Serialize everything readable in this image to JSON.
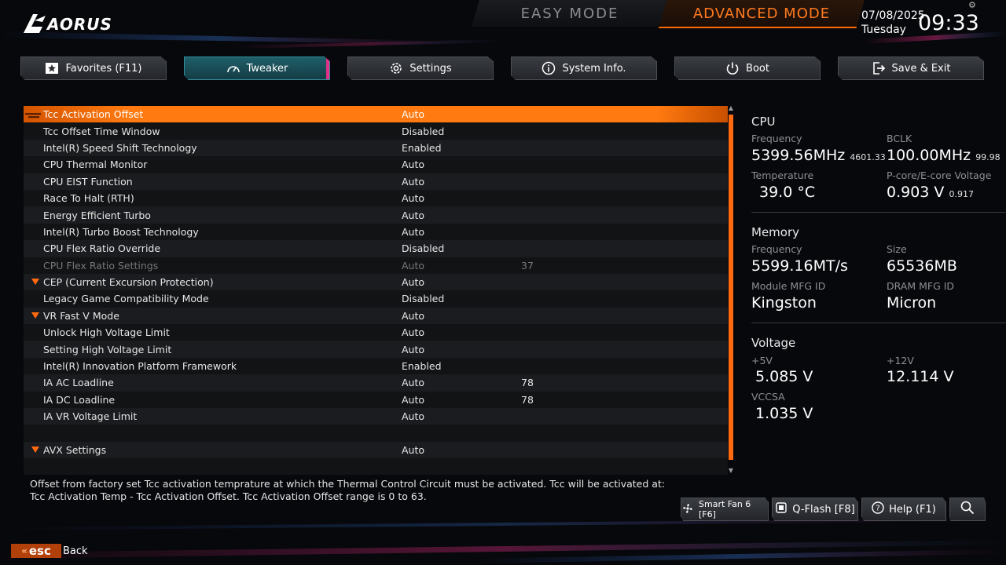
{
  "header": {
    "logo_text": "AORUS",
    "easy_mode": "EASY MODE",
    "advanced_mode": "ADVANCED MODE",
    "date": "07/08/2025",
    "day": "Tuesday",
    "time": "09:33"
  },
  "tabs": [
    {
      "label": "Favorites (F11)",
      "icon": "star-icon"
    },
    {
      "label": "Tweaker",
      "icon": "speedometer-icon",
      "active": true
    },
    {
      "label": "Settings",
      "icon": "gear-icon"
    },
    {
      "label": "System Info.",
      "icon": "info-icon"
    },
    {
      "label": "Boot",
      "icon": "power-icon"
    },
    {
      "label": "Save & Exit",
      "icon": "exit-icon"
    }
  ],
  "settings": [
    {
      "name": "Tcc Activation Offset",
      "value": "Auto",
      "num": "",
      "selected": true
    },
    {
      "name": "Tcc Offset Time Window",
      "value": "Disabled",
      "num": ""
    },
    {
      "name": "Intel(R) Speed Shift Technology",
      "value": "Enabled",
      "num": ""
    },
    {
      "name": "CPU Thermal Monitor",
      "value": "Auto",
      "num": ""
    },
    {
      "name": "CPU EIST Function",
      "value": "Auto",
      "num": ""
    },
    {
      "name": "Race To Halt (RTH)",
      "value": "Auto",
      "num": ""
    },
    {
      "name": "Energy Efficient Turbo",
      "value": "Auto",
      "num": ""
    },
    {
      "name": "Intel(R) Turbo Boost Technology",
      "value": "Auto",
      "num": ""
    },
    {
      "name": "CPU Flex Ratio Override",
      "value": "Disabled",
      "num": ""
    },
    {
      "name": "CPU Flex Ratio Settings",
      "value": "Auto",
      "num": "37",
      "dim": true
    },
    {
      "name": "CEP (Current Excursion Protection)",
      "value": "Auto",
      "num": "",
      "expand": true
    },
    {
      "name": "Legacy Game Compatibility Mode",
      "value": "Disabled",
      "num": ""
    },
    {
      "name": "VR Fast V Mode",
      "value": "Auto",
      "num": "",
      "expand": true
    },
    {
      "name": "Unlock High Voltage Limit",
      "value": "Auto",
      "num": ""
    },
    {
      "name": "Setting High Voltage Limit",
      "value": "Auto",
      "num": ""
    },
    {
      "name": "Intel(R) Innovation Platform Framework",
      "value": "Enabled",
      "num": ""
    },
    {
      "name": "IA AC Loadline",
      "value": "Auto",
      "num": "78"
    },
    {
      "name": "IA DC Loadline",
      "value": "Auto",
      "num": "78"
    },
    {
      "name": "IA VR Voltage Limit",
      "value": "Auto",
      "num": ""
    },
    {
      "name": "",
      "value": "",
      "num": ""
    },
    {
      "name": "AVX Settings",
      "value": "Auto",
      "num": "",
      "expand": true
    },
    {
      "name": "",
      "value": "",
      "num": ""
    }
  ],
  "info": {
    "cpu": {
      "title": "CPU",
      "freq_label": "Frequency",
      "freq": "5399.56MHz",
      "freq_sub": "4601.33",
      "bclk_label": "BCLK",
      "bclk": "100.00MHz",
      "bclk_sub": "99.98",
      "temp_label": "Temperature",
      "temp": "39.0 °C",
      "volt_label": "P-core/E-core Voltage",
      "volt": "0.903 V",
      "volt_sub": "0.917"
    },
    "memory": {
      "title": "Memory",
      "freq_label": "Frequency",
      "freq": "5599.16MT/s",
      "size_label": "Size",
      "size": "65536MB",
      "module_label": "Module MFG ID",
      "module": "Kingston",
      "dram_label": "DRAM MFG ID",
      "dram": "Micron"
    },
    "voltage": {
      "title": "Voltage",
      "v5_label": "+5V",
      "v5": "5.085 V",
      "v12_label": "+12V",
      "v12": "12.114 V",
      "vccsa_label": "VCCSA",
      "vccsa": "1.035 V"
    }
  },
  "description": "Offset from factory set Tcc activation temprature at which the Thermal Control Circuit must be activated. Tcc will be activated at: Tcc Activation Temp - Tcc Activation Offset. Tcc Activation Offset range is 0 to 63.",
  "bottom": {
    "smartfan": "Smart Fan 6 [F6]",
    "qflash": "Q-Flash [F8]",
    "help": "Help (F1)"
  },
  "esc": {
    "key": "esc",
    "label": "Back"
  },
  "colors": {
    "accent": "#ff6a10",
    "tab_active": "#1f5f6a",
    "background": "#07080b"
  }
}
